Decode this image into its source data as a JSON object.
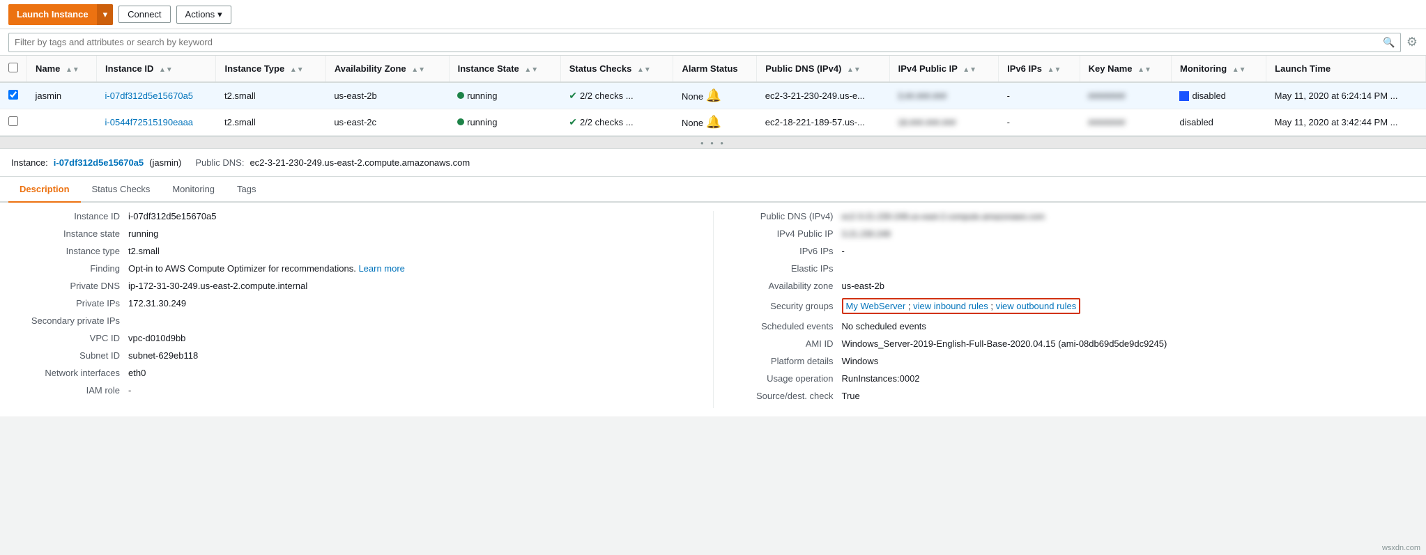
{
  "toolbar": {
    "launch_label": "Launch Instance",
    "connect_label": "Connect",
    "actions_label": "Actions"
  },
  "search": {
    "placeholder": "Filter by tags and attributes or search by keyword"
  },
  "table": {
    "columns": [
      "Name",
      "Instance ID",
      "Instance Type",
      "Availability Zone",
      "Instance State",
      "Status Checks",
      "Alarm Status",
      "Public DNS (IPv4)",
      "IPv4 Public IP",
      "IPv6 IPs",
      "Key Name",
      "Monitoring",
      "Launch Time"
    ],
    "rows": [
      {
        "selected": true,
        "name": "jasmin",
        "instance_id": "i-07df312d5e15670a5",
        "instance_type": "t2.small",
        "availability_zone": "us-east-2b",
        "instance_state": "running",
        "status_checks": "2/2 checks ...",
        "alarm_status": "None",
        "public_dns": "ec2-3-21-230-249.us-e...",
        "ipv4_public_ip": "3.##.###.###",
        "ipv6_ips": "-",
        "key_name": "########",
        "monitoring": "disabled",
        "launch_time": "May 11, 2020 at 6:24:14 PM ..."
      },
      {
        "selected": false,
        "name": "",
        "instance_id": "i-0544f72515190eaaa",
        "instance_type": "t2.small",
        "availability_zone": "us-east-2c",
        "instance_state": "running",
        "status_checks": "2/2 checks ...",
        "alarm_status": "None",
        "public_dns": "ec2-18-221-189-57.us-...",
        "ipv4_public_ip": "18.###.###.###",
        "ipv6_ips": "-",
        "key_name": "########",
        "monitoring": "disabled",
        "launch_time": "May 11, 2020 at 3:42:44 PM ..."
      }
    ]
  },
  "divider": {
    "dots": "• • •"
  },
  "instance_detail_header": {
    "label": "Instance:",
    "id": "i-07df312d5e15670a5",
    "name": "(jasmin)",
    "dns_label": "Public DNS:",
    "dns": "ec2-3-21-230-249.us-east-2.compute.amazonaws.com"
  },
  "tabs": [
    "Description",
    "Status Checks",
    "Monitoring",
    "Tags"
  ],
  "active_tab": "Description",
  "description": {
    "left": {
      "instance_id_label": "Instance ID",
      "instance_id_value": "i-07df312d5e15670a5",
      "instance_state_label": "Instance state",
      "instance_state_value": "running",
      "instance_type_label": "Instance type",
      "instance_type_value": "t2.small",
      "finding_label": "Finding",
      "finding_value": "Opt-in to AWS Compute Optimizer for recommendations.",
      "finding_link": "Learn more",
      "private_dns_label": "Private DNS",
      "private_dns_value": "ip-172-31-30-249.us-east-2.compute.internal",
      "private_ips_label": "Private IPs",
      "private_ips_value": "172.31.30.249",
      "secondary_ips_label": "Secondary private IPs",
      "secondary_ips_value": "",
      "vpc_id_label": "VPC ID",
      "vpc_id_value": "vpc-d010d9bb",
      "subnet_id_label": "Subnet ID",
      "subnet_id_value": "subnet-629eb118",
      "network_interfaces_label": "Network interfaces",
      "network_interfaces_value": "eth0",
      "iam_role_label": "IAM role",
      "iam_role_value": "-"
    },
    "right": {
      "public_dns_label": "Public DNS (IPv4)",
      "public_dns_value": "ec2-3-21-230-249.us-east-2.compute.amazonaws.com",
      "ipv4_label": "IPv4 Public IP",
      "ipv4_value": "3.21.230.249",
      "ipv6_label": "IPv6 IPs",
      "ipv6_value": "-",
      "elastic_ips_label": "Elastic IPs",
      "elastic_ips_value": "",
      "availability_zone_label": "Availability zone",
      "availability_zone_value": "us-east-2b",
      "security_groups_label": "Security groups",
      "security_groups_link": "My WebServer",
      "security_groups_inbound": "view inbound rules",
      "security_groups_outbound": "view outbound rules",
      "scheduled_events_label": "Scheduled events",
      "scheduled_events_value": "No scheduled events",
      "ami_id_label": "AMI ID",
      "ami_id_value": "Windows_Server-2019-English-Full-Base-2020.04.15 (ami-08db69d5de9dc9245)",
      "platform_label": "Platform details",
      "platform_value": "Windows",
      "usage_operation_label": "Usage operation",
      "usage_operation_value": "RunInstances:0002",
      "source_dest_label": "Source/dest. check",
      "source_dest_value": "True"
    }
  }
}
